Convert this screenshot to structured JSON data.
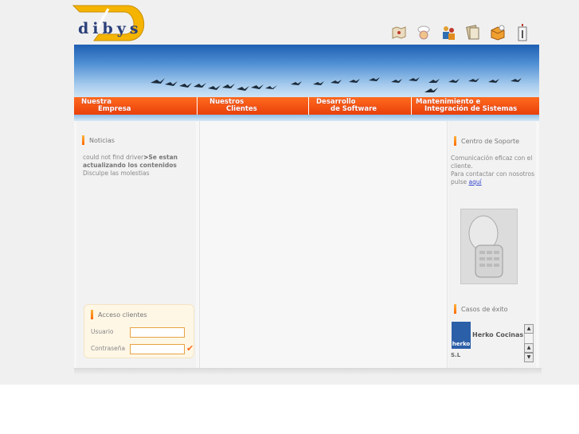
{
  "logo": {
    "text": "dibys"
  },
  "toolbar": {
    "icons": [
      "map-icon",
      "chef-icon",
      "people-icon",
      "documents-icon",
      "box-icon",
      "info-icon"
    ]
  },
  "nav": [
    {
      "line1": "Nuestra",
      "line2": "Empresa"
    },
    {
      "line1": "Nuestros",
      "line2": "Clientes"
    },
    {
      "line1": "Desarrollo",
      "line2": "de Software"
    },
    {
      "line1": "Mantenimiento e",
      "line2": "Integración de Sistemas"
    }
  ],
  "noticias": {
    "title": "Noticias",
    "error": "could not find driver",
    "msg_bold": "Se estan actualizando los contenidos",
    "msg": "Disculpe las molestias"
  },
  "login": {
    "title": "Acceso clientes",
    "user_label": "Usuario",
    "pass_label": "Contraseña",
    "user_value": "",
    "pass_value": ""
  },
  "soporte": {
    "title": "Centro de Soporte",
    "text": "Comunicación eficaz con el cliente.",
    "contact": "Para contactar con nosotros pulse",
    "link": "aquí"
  },
  "casos": {
    "title": "Casos de éxito",
    "company": "Herko Cocinas",
    "suffix": "S.L",
    "logo_text": "herko"
  },
  "colors": {
    "accent": "#ff5a14",
    "sky": "#3f82cc",
    "link": "#3344cc"
  }
}
